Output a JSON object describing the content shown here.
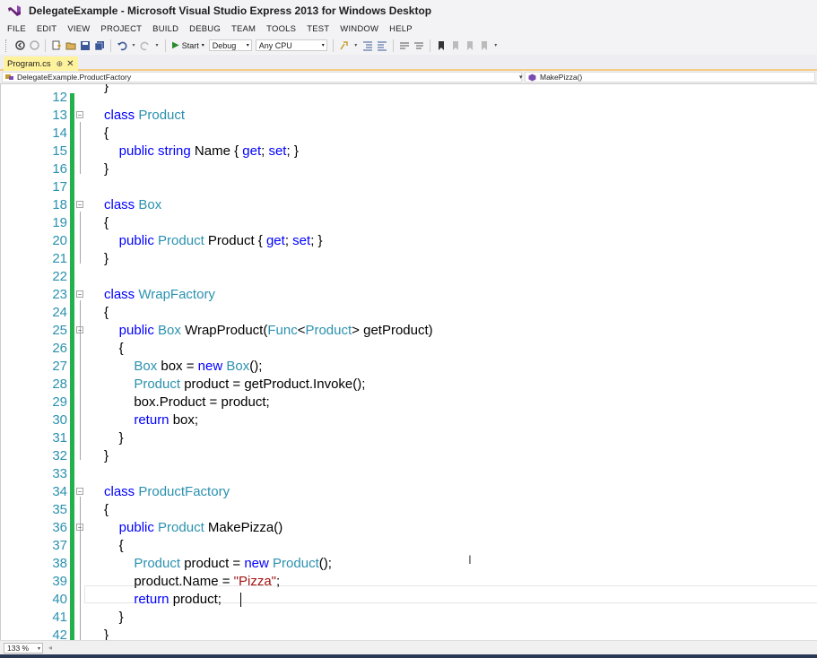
{
  "window": {
    "title": "DelegateExample - Microsoft Visual Studio Express 2013 for Windows Desktop"
  },
  "menu": [
    "FILE",
    "EDIT",
    "VIEW",
    "PROJECT",
    "BUILD",
    "DEBUG",
    "TEAM",
    "TOOLS",
    "TEST",
    "WINDOW",
    "HELP"
  ],
  "toolbar": {
    "start_label": "Start",
    "config_value": "Debug",
    "platform_value": "Any CPU"
  },
  "tab": {
    "label": "Program.cs",
    "pin": "⊕",
    "close": "✕"
  },
  "navbar": {
    "left": "DelegateExample.ProductFactory",
    "right": "MakePizza()"
  },
  "code_lines": [
    {
      "n": "12"
    },
    {
      "n": "13"
    },
    {
      "n": "14"
    },
    {
      "n": "15"
    },
    {
      "n": "16"
    },
    {
      "n": "17"
    },
    {
      "n": "18"
    },
    {
      "n": "19"
    },
    {
      "n": "20"
    },
    {
      "n": "21"
    },
    {
      "n": "22"
    },
    {
      "n": "23"
    },
    {
      "n": "24"
    },
    {
      "n": "25"
    },
    {
      "n": "26"
    },
    {
      "n": "27"
    },
    {
      "n": "28"
    },
    {
      "n": "29"
    },
    {
      "n": "30"
    },
    {
      "n": "31"
    },
    {
      "n": "32"
    },
    {
      "n": "33"
    },
    {
      "n": "34"
    },
    {
      "n": "35"
    },
    {
      "n": "36"
    },
    {
      "n": "37"
    },
    {
      "n": "38"
    },
    {
      "n": "39"
    },
    {
      "n": "40"
    },
    {
      "n": "41"
    },
    {
      "n": "42"
    }
  ],
  "status": {
    "zoom": "133 %"
  },
  "colors": {
    "keyword": "#0000ff",
    "type": "#2b91af",
    "string": "#a31515",
    "change_bar": "#22b14c",
    "tab_active": "#fff29d"
  },
  "icons": [
    "visual-studio-logo",
    "back-icon",
    "forward-icon",
    "new-project-icon",
    "open-icon",
    "save-icon",
    "save-all-icon",
    "undo-icon",
    "redo-icon",
    "play-icon",
    "find-icon",
    "bookmark-icon"
  ]
}
